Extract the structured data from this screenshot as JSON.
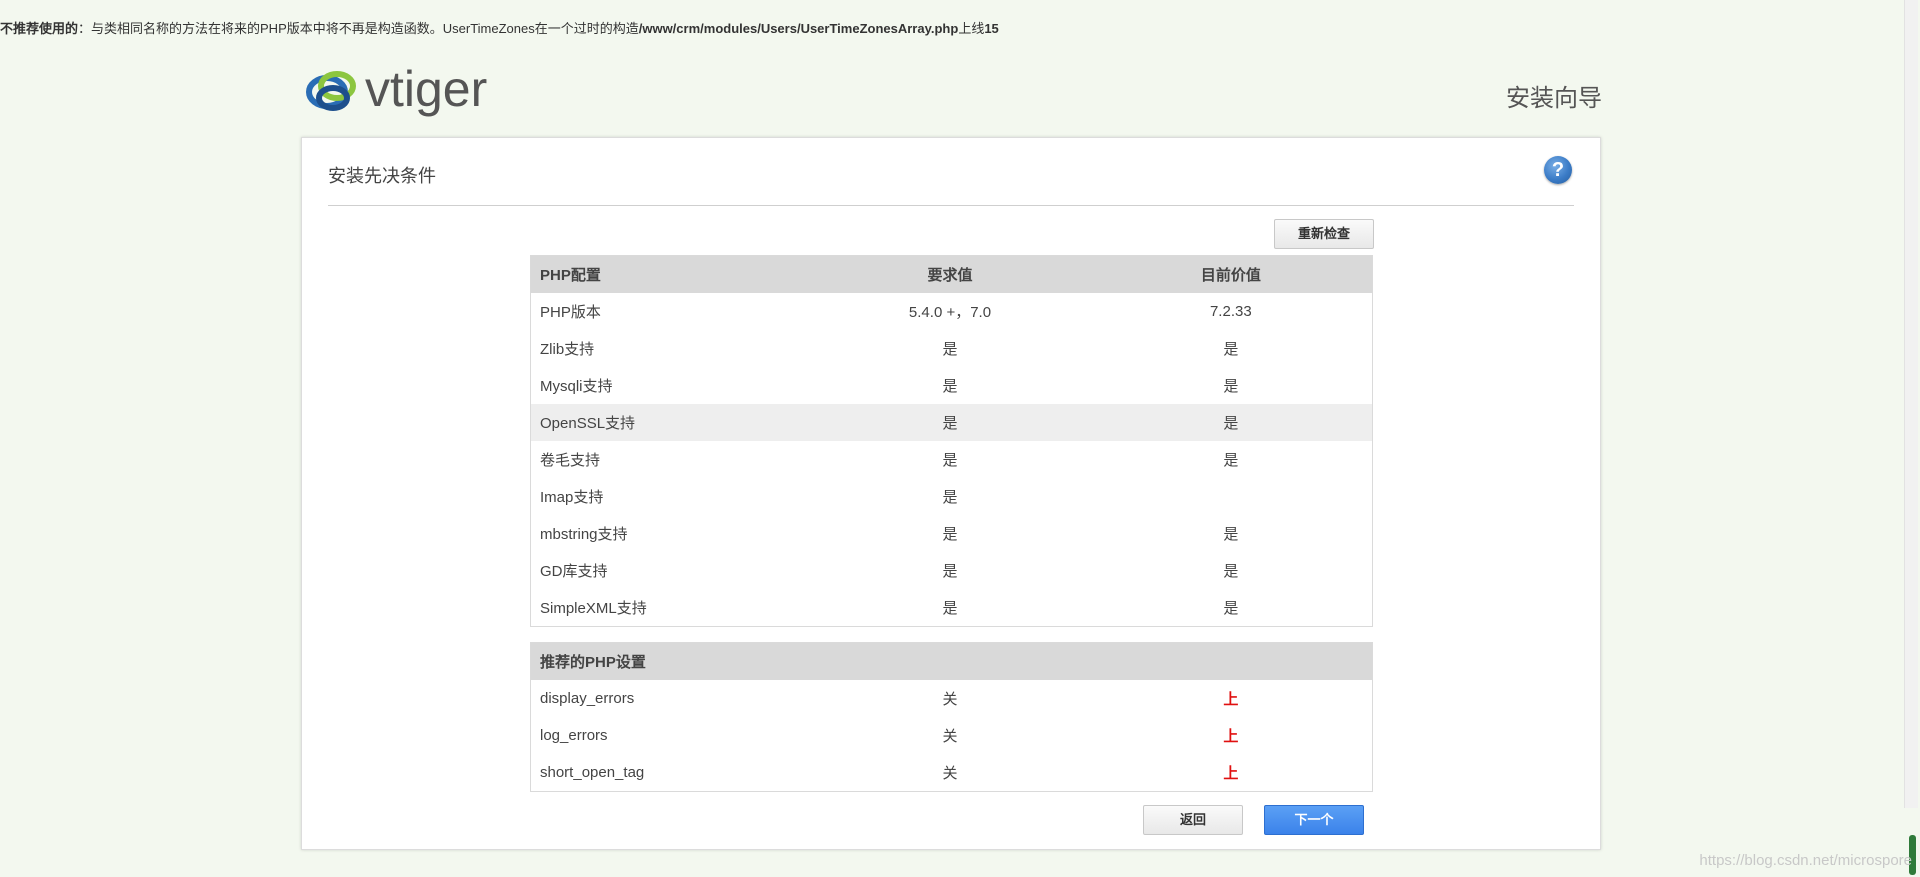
{
  "notice": {
    "label": "不推荐使用的",
    "message": "：与类相同名称的方法在将来的PHP版本中将不再是构造函数。UserTimeZones在一个过时的构造",
    "path": "/www/crm/modules/Users/UserTimeZonesArray.php",
    "line_label": "上线",
    "line_number": "15"
  },
  "header": {
    "logo_text": "vtiger",
    "title": "安装向导"
  },
  "card": {
    "title": "安装先决条件",
    "recheck_label": "重新检查",
    "back_label": "返回",
    "next_label": "下一个"
  },
  "php_table": {
    "headers": [
      "PHP配置",
      "要求值",
      "目前价值"
    ],
    "rows": [
      {
        "name": "PHP版本",
        "required": "5.4.0 +，7.0",
        "current": "7.2.33"
      },
      {
        "name": "Zlib支持",
        "required": "是",
        "current": "是"
      },
      {
        "name": "Mysqli支持",
        "required": "是",
        "current": "是"
      },
      {
        "name": "OpenSSL支持",
        "required": "是",
        "current": "是"
      },
      {
        "name": "卷毛支持",
        "required": "是",
        "current": "是"
      },
      {
        "name": "Imap支持",
        "required": "是",
        "current": ""
      },
      {
        "name": "mbstring支持",
        "required": "是",
        "current": "是"
      },
      {
        "name": "GD库支持",
        "required": "是",
        "current": "是"
      },
      {
        "name": "SimpleXML支持",
        "required": "是",
        "current": "是"
      }
    ]
  },
  "rec_table": {
    "header": "推荐的PHP设置",
    "rows": [
      {
        "name": "display_errors",
        "required": "关",
        "current": "上"
      },
      {
        "name": "log_errors",
        "required": "关",
        "current": "上"
      },
      {
        "name": "short_open_tag",
        "required": "关",
        "current": "上"
      }
    ]
  },
  "watermark": "https://blog.csdn.net/microspore",
  "colors": {
    "background": "#f3f8ef",
    "accent_button": "#3b82ea",
    "warning_value": "#e01010",
    "table_header": "#d9d9d9"
  }
}
